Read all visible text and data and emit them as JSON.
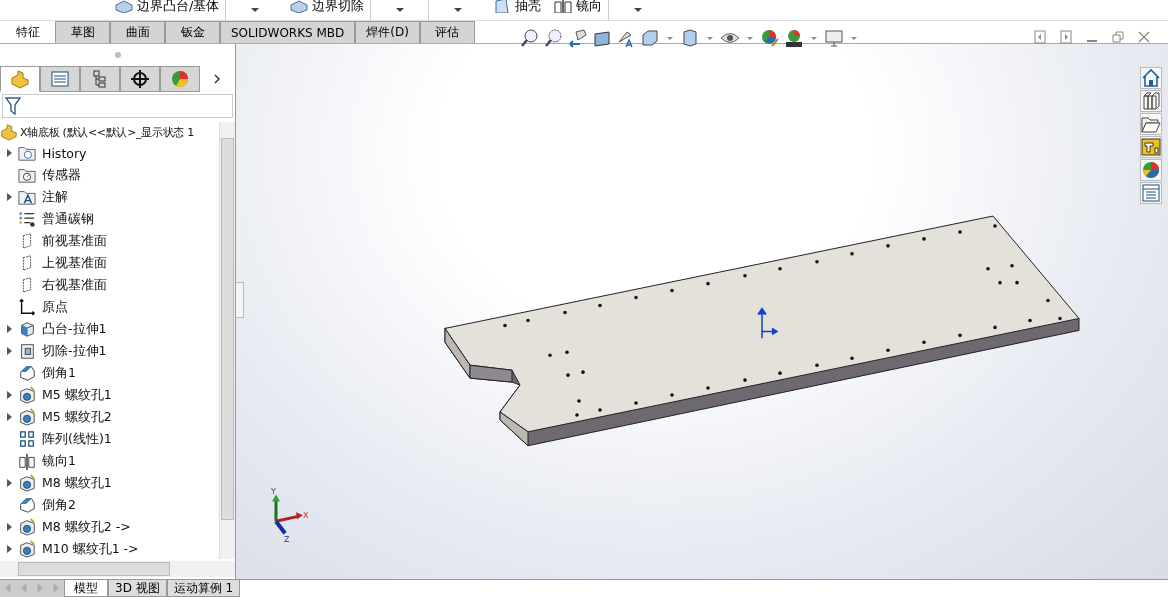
{
  "command_bar": [
    {
      "kind": "command",
      "label": "边界凸台/基体"
    },
    {
      "kind": "dropdown"
    },
    {
      "kind": "command",
      "label": "边界切除"
    },
    {
      "kind": "dropdown"
    },
    {
      "kind": "dropdown"
    },
    {
      "kind": "command",
      "label": "抽壳"
    },
    {
      "kind": "command",
      "label": "镜向"
    },
    {
      "kind": "dropdown"
    }
  ],
  "tabs": [
    {
      "label": "特征",
      "selected": true
    },
    {
      "label": "草图",
      "selected": false
    },
    {
      "label": "曲面",
      "selected": false
    },
    {
      "label": "钣金",
      "selected": false
    },
    {
      "label": "SOLIDWORKS MBD",
      "selected": false
    },
    {
      "label": "焊件(D)",
      "selected": false
    },
    {
      "label": "评估",
      "selected": false
    }
  ],
  "panel_tabs": [
    {
      "selected": true
    },
    {
      "selected": false
    },
    {
      "selected": false
    },
    {
      "selected": false
    },
    {
      "selected": false
    }
  ],
  "tree": {
    "root": "X轴底板  (默认<<默认>_显示状态 1",
    "items": [
      {
        "label": "History",
        "kind": "history",
        "expandable": true
      },
      {
        "label": "传感器",
        "kind": "sensor",
        "expandable": false
      },
      {
        "label": "注解",
        "kind": "annotation",
        "expandable": true
      },
      {
        "label": "普通碳钢",
        "kind": "material",
        "expandable": false
      },
      {
        "label": "前视基准面",
        "kind": "plane",
        "expandable": false
      },
      {
        "label": "上视基准面",
        "kind": "plane",
        "expandable": false
      },
      {
        "label": "右视基准面",
        "kind": "plane",
        "expandable": false
      },
      {
        "label": "原点",
        "kind": "origin",
        "expandable": false
      },
      {
        "label": "凸台-拉伸1",
        "kind": "extrude",
        "expandable": true
      },
      {
        "label": "切除-拉伸1",
        "kind": "cut",
        "expandable": true
      },
      {
        "label": "倒角1",
        "kind": "chamfer",
        "expandable": false
      },
      {
        "label": "M5 螺纹孔1",
        "kind": "hole",
        "expandable": true
      },
      {
        "label": "M5 螺纹孔2",
        "kind": "hole",
        "expandable": true
      },
      {
        "label": "阵列(线性)1",
        "kind": "pattern",
        "expandable": false
      },
      {
        "label": "镜向1",
        "kind": "mirror",
        "expandable": false
      },
      {
        "label": "M8 螺纹孔1",
        "kind": "hole",
        "expandable": true
      },
      {
        "label": "倒角2",
        "kind": "chamfer",
        "expandable": false
      },
      {
        "label": "M8 螺纹孔2 ->",
        "kind": "hole",
        "expandable": true
      },
      {
        "label": "M10 螺纹孔1 ->",
        "kind": "hole",
        "expandable": true
      }
    ]
  },
  "bottom_tabs": [
    {
      "label": "模型",
      "selected": true
    },
    {
      "label": "3D 视图",
      "selected": false
    },
    {
      "label": "运动算例 1",
      "selected": false
    }
  ],
  "triad": {
    "x": "X",
    "y": "Y",
    "z": "Z"
  }
}
